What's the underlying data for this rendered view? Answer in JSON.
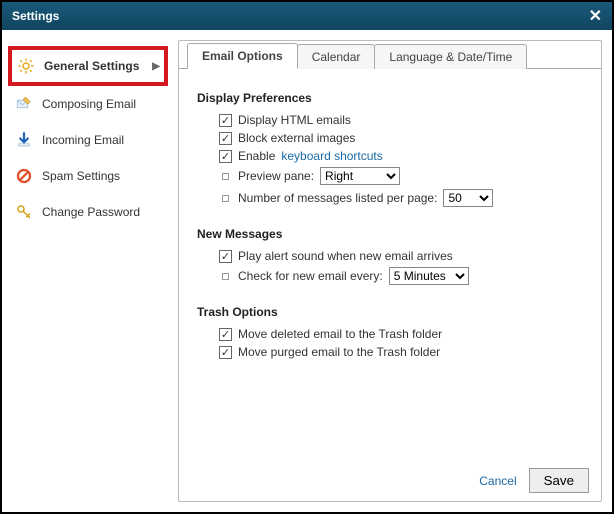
{
  "window": {
    "title": "Settings"
  },
  "sidebar": {
    "items": [
      {
        "label": "General Settings"
      },
      {
        "label": "Composing Email"
      },
      {
        "label": "Incoming Email"
      },
      {
        "label": "Spam Settings"
      },
      {
        "label": "Change Password"
      }
    ]
  },
  "tabs": {
    "email": "Email Options",
    "calendar": "Calendar",
    "lang": "Language & Date/Time"
  },
  "sections": {
    "display": {
      "title": "Display Preferences",
      "html_emails": "Display HTML emails",
      "block_images": "Block external images",
      "enable_prefix": "Enable",
      "shortcuts_link": "keyboard shortcuts",
      "preview_label": "Preview pane:",
      "preview_value": "Right",
      "perpage_label": "Number of messages listed per page:",
      "perpage_value": "50"
    },
    "newmsg": {
      "title": "New Messages",
      "alert": "Play alert sound when new email arrives",
      "check_label": "Check for new email every:",
      "check_value": "5 Minutes"
    },
    "trash": {
      "title": "Trash Options",
      "deleted": "Move deleted email to the Trash folder",
      "purged": "Move purged email to the Trash folder"
    }
  },
  "footer": {
    "cancel": "Cancel",
    "save": "Save"
  }
}
